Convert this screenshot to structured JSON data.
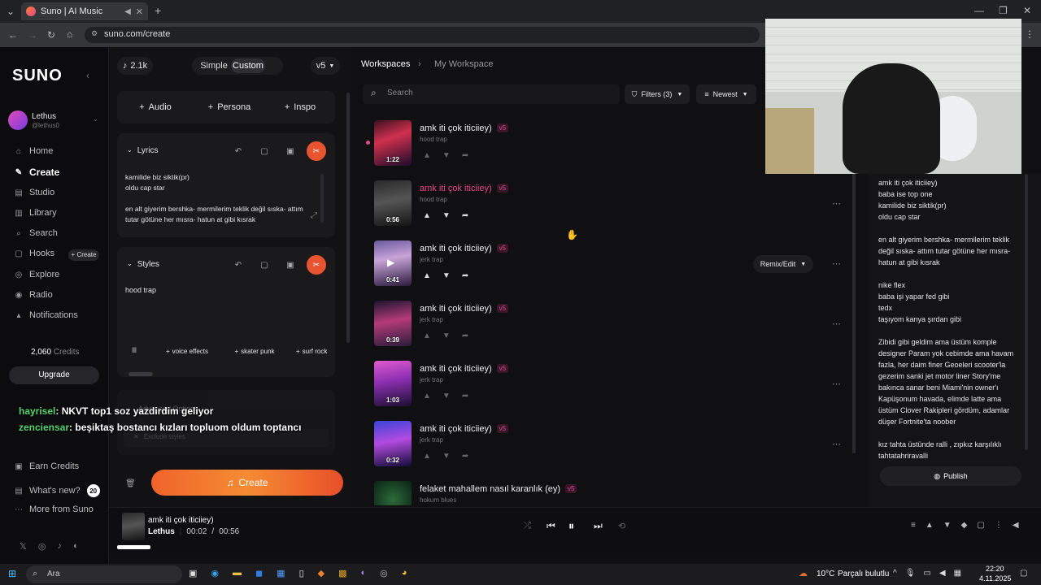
{
  "browser": {
    "tab_title": "Suno | AI Music",
    "url": "suno.com/create"
  },
  "sidebar": {
    "logo": "SUNO",
    "user": {
      "name": "Lethus",
      "handle": "@lethus0"
    },
    "items": [
      {
        "label": "Home",
        "icon": "home-icon"
      },
      {
        "label": "Create",
        "icon": "create-icon"
      },
      {
        "label": "Studio",
        "icon": "studio-icon"
      },
      {
        "label": "Library",
        "icon": "library-icon"
      },
      {
        "label": "Search",
        "icon": "search-icon"
      },
      {
        "label": "Hooks",
        "icon": "hooks-icon"
      },
      {
        "label": "Explore",
        "icon": "explore-icon"
      },
      {
        "label": "Radio",
        "icon": "radio-icon"
      },
      {
        "label": "Notifications",
        "icon": "bell-icon"
      }
    ],
    "hooks_create": "+ Create",
    "credits_value": "2,060",
    "credits_label": "Credits",
    "upgrade": "Upgrade",
    "earn_credits": "Earn Credits",
    "whats_new": "What's new?",
    "whats_new_badge": "20",
    "more_from_suno": "More from Suno"
  },
  "create": {
    "count": "2.1k",
    "mode_simple": "Simple",
    "mode_custom": "Custom",
    "version": "v5",
    "add_audio": "Audio",
    "add_persona": "Persona",
    "add_inspo": "Inspo",
    "lyrics_label": "Lyrics",
    "lyrics_text": "kamilide biz siktik(pr)\noldu cap star\n\nen alt giyerim bershka- mermilerim teklik değil sıska- attım tutar götüne her mısra- hatun at gibi kısrak",
    "styles_label": "Styles",
    "styles_text": "hood trap",
    "chips": [
      "voice effects",
      "skater punk",
      "surf rock"
    ],
    "advanced_options": "Advanced Options",
    "exclude_styles": "Exclude styles",
    "create_button": "Create"
  },
  "chat_overlay": [
    {
      "user": "hayrisel",
      "message": ": NKVT top1 soz yazdirdim geliyor"
    },
    {
      "user": "zenciensar",
      "message": ": beşiktaş bostancı kızları topluom oldum toptancı"
    }
  ],
  "workspace": {
    "breadcrumb_root": "Workspaces",
    "breadcrumb_current": "My Workspace",
    "search_placeholder": "Search",
    "filters": "Filters (3)",
    "sort": "Newest",
    "remix_edit": "Remix/Edit",
    "songs": [
      {
        "title": "amk iti çok iticiiey)",
        "version": "v5",
        "style": "hood trap",
        "duration": "1:22",
        "highlight": false
      },
      {
        "title": "amk iti çok iticiiey)",
        "version": "v5",
        "style": "hood trap",
        "duration": "0:56",
        "highlight": true
      },
      {
        "title": "amk iti çok iticiiey)",
        "version": "v5",
        "style": "jerk trap",
        "duration": "0:41",
        "highlight": false
      },
      {
        "title": "amk iti çok iticiiey)",
        "version": "v5",
        "style": "jerk trap",
        "duration": "0:39",
        "highlight": false
      },
      {
        "title": "amk iti çok iticiiey)",
        "version": "v5",
        "style": "jerk trap",
        "duration": "1:03",
        "highlight": false
      },
      {
        "title": "amk iti çok iticiiey)",
        "version": "v5",
        "style": "jerk trap",
        "duration": "0:32",
        "highlight": false
      },
      {
        "title": "felaket mahallem nasıl karanlık (ey)",
        "version": "v5",
        "style": "hokum blues",
        "duration": "",
        "highlight": false
      }
    ]
  },
  "lyrics_panel": {
    "text": "amk iti çok iticiiey)\nbaba ise top one\nkamilide biz siktik(pr)\noldu cap star\n\nen alt giyerim bershka- mermilerim teklik değil sıska- attım tutar götüne her mısra- hatun at gibi kısrak\n\nnike flex\nbaba işi yapar fed gibi\ntedx\ntaşıyom kanya şırdan gibi\n\nZibidi gibi geldim ama üstüm komple designer Param yok cebimde ama havam fazla, her daim finer Geoeleri scooter'la gezerim sanki jet motor liner Story'me bakınca sanar beni Miami'nin owner'ı Kapüşonum havada, elimde latte ama üstüm Clover Rakipleri gördüm, adamlar düşer Fortnite'ta noober\n\nkız tahta üstünde ralli , zıpkız karşılıklı tahtatahriravalli",
    "publish": "Publish"
  },
  "player": {
    "title": "amk iti çok iticiiey)",
    "artist": "Lethus",
    "current": "00:02",
    "separator": "/",
    "total": "00:56",
    "progress": 0.036
  },
  "taskbar": {
    "search_placeholder": "Ara",
    "temperature": "10°C",
    "weather": "Parçalı bulutlu",
    "time": "22:20",
    "date": "4.11.2025"
  }
}
